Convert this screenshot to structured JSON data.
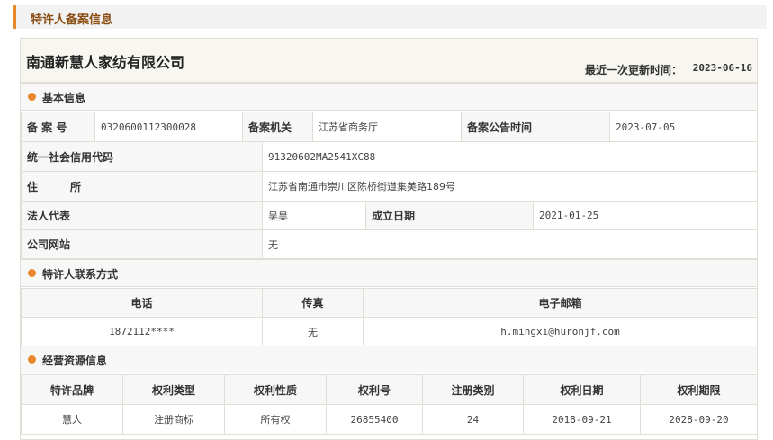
{
  "header": {
    "title": "特许人备案信息"
  },
  "company": {
    "name": "南通新慧人家纺有限公司",
    "update_label": "最近一次更新时间：",
    "update_date": "2023-06-16"
  },
  "basic": {
    "section_title": "基本信息",
    "record_no_label": "备 案 号",
    "record_no": "0320600112300028",
    "authority_label": "备案机关",
    "authority": "江苏省商务厅",
    "announce_label": "备案公告时间",
    "announce_date": "2023-07-05",
    "credit_label": "统一社会信用代码",
    "credit_code": "91320602MA2541XC88",
    "address_label": "住　　　所",
    "address": "江苏省南通市崇川区陈桥街道集美路189号",
    "legal_rep_label": "法人代表",
    "legal_rep": "吴昊",
    "founded_label": "成立日期",
    "founded_date": "2021-01-25",
    "website_label": "公司网站",
    "website": "无"
  },
  "contact": {
    "section_title": "特许人联系方式",
    "headers": [
      "电话",
      "传真",
      "电子邮箱"
    ],
    "phone": "1872112****",
    "fax": "无",
    "email": "h.mingxi@huronjf.com"
  },
  "resources": {
    "section_title": "经营资源信息",
    "headers": [
      "特许品牌",
      "权利类型",
      "权利性质",
      "权利号",
      "注册类别",
      "权利日期",
      "权利期限"
    ],
    "rows": [
      [
        "慧人",
        "注册商标",
        "所有权",
        "26855400",
        "24",
        "2018-09-21",
        "2028-09-20"
      ]
    ]
  },
  "colors": {
    "accent": "#e8892b",
    "header_text": "#8a4e14",
    "border": "#e2ddd5",
    "label_bg": "#f7f7f7"
  }
}
